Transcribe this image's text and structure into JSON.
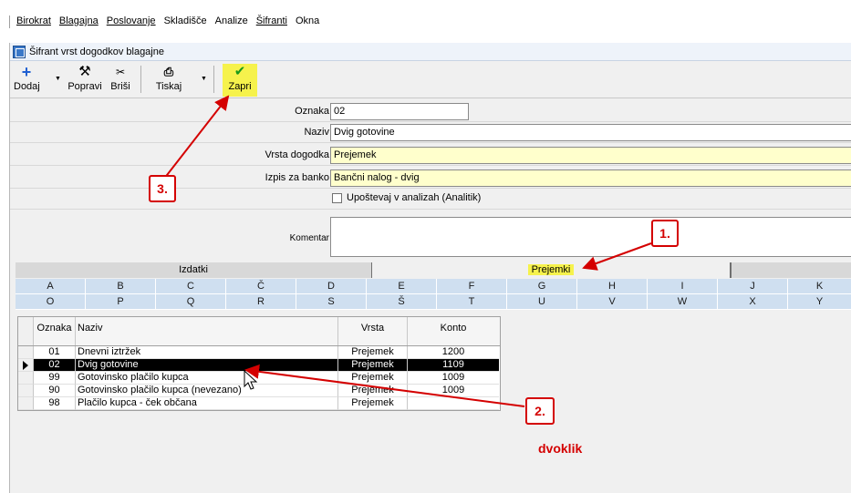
{
  "menu": {
    "items": [
      "Birokrat",
      "Blagajna",
      "Poslovanje",
      "Skladišče",
      "Analize",
      "Šifranti",
      "Okna"
    ]
  },
  "window": {
    "title": "Šifrant vrst dogodkov blagajne"
  },
  "toolbar": {
    "dodaj": "Dodaj",
    "popravi": "Popravi",
    "brisi": "Briši",
    "tiskaj": "Tiskaj",
    "zapri": "Zapri"
  },
  "form": {
    "oznaka_label": "Oznaka",
    "oznaka_value": "02",
    "naziv_label": "Naziv",
    "naziv_value": "Dvig gotovine",
    "vrsta_label": "Vrsta dogodka",
    "vrsta_value": "Prejemek",
    "izpis_label": "Izpis za banko",
    "izpis_value": "Bančni nalog - dvig",
    "upostevaj_label": "Upoštevaj v analizah (Analitik)",
    "komentar_label": "Komentar"
  },
  "tabs": {
    "izdatki": "Izdatki",
    "prejemki": "Prejemki"
  },
  "letters": {
    "row1": [
      "A",
      "B",
      "C",
      "Č",
      "D",
      "E",
      "F",
      "G",
      "H",
      "I",
      "J",
      "K"
    ],
    "row2": [
      "O",
      "P",
      "Q",
      "R",
      "S",
      "Š",
      "T",
      "U",
      "V",
      "W",
      "X",
      "Y"
    ]
  },
  "table": {
    "headers": {
      "oznaka": "Oznaka",
      "naziv": "Naziv",
      "vrsta": "Vrsta",
      "konto": "Konto"
    },
    "rows": [
      {
        "oznaka": "01",
        "naziv": "Dnevni iztržek",
        "vrsta": "Prejemek",
        "konto": "1200"
      },
      {
        "oznaka": "02",
        "naziv": "Dvig gotovine",
        "vrsta": "Prejemek",
        "konto": "1109"
      },
      {
        "oznaka": "99",
        "naziv": "Gotovinsko plačilo kupca",
        "vrsta": "Prejemek",
        "konto": "1009"
      },
      {
        "oznaka": "90",
        "naziv": "Gotovinsko plačilo kupca (nevezano)",
        "vrsta": "Prejemek",
        "konto": "1009"
      },
      {
        "oznaka": "98",
        "naziv": "Plačilo kupca - ček občana",
        "vrsta": "Prejemek",
        "konto": ""
      }
    ],
    "selected_row": 1
  },
  "annotations": {
    "step1": "1.",
    "step2": "2.",
    "step3": "3.",
    "dvoklik": "dvoklik"
  },
  "colors": {
    "highlight": "#f6f24c",
    "annotation_red": "#d40000",
    "letter_cell": "#cfdff0"
  }
}
